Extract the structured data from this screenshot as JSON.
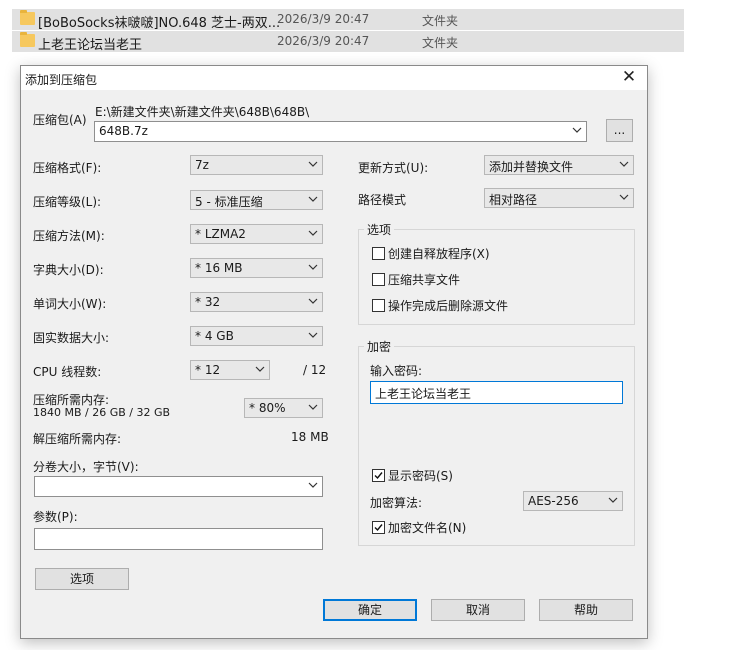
{
  "explorer": {
    "rows": [
      {
        "name": "[BoBoSocks袜啵啵]NO.648 芝士-两双...",
        "date": "2026/3/9 20:47",
        "type": "文件夹"
      },
      {
        "name": "上老王论坛当老王",
        "date": "2026/3/9 20:47",
        "type": "文件夹"
      }
    ]
  },
  "dialog": {
    "title": "添加到压缩包",
    "archive": {
      "label": "压缩包(A)",
      "path": "E:\\新建文件夹\\新建文件夹\\648B\\648B\\",
      "value": "648B.7z",
      "browse": "..."
    },
    "format": {
      "label": "压缩格式(F):",
      "value": "7z"
    },
    "level": {
      "label": "压缩等级(L):",
      "value": "5 - 标准压缩"
    },
    "method": {
      "label": "压缩方法(M):",
      "value": "* LZMA2"
    },
    "dict": {
      "label": "字典大小(D):",
      "value": "* 16 MB"
    },
    "word": {
      "label": "单词大小(W):",
      "value": "* 32"
    },
    "solid": {
      "label": "固实数据大小:",
      "value": "* 4 GB"
    },
    "threads": {
      "label": "CPU 线程数:",
      "value": "* 12",
      "total": "/ 12"
    },
    "mem_comp": {
      "label": "压缩所需内存:",
      "detail": "1840 MB / 26 GB / 32 GB",
      "value": "* 80%"
    },
    "mem_decomp": {
      "label": "解压缩所需内存:",
      "value": "18 MB"
    },
    "volume": {
      "label": "分卷大小，字节(V):",
      "value": ""
    },
    "params": {
      "label": "参数(P):",
      "value": ""
    },
    "options_btn": "选项",
    "update": {
      "label": "更新方式(U):",
      "value": "添加并替换文件"
    },
    "pathmode": {
      "label": "路径模式",
      "value": "相对路径"
    },
    "options_group": {
      "title": "选项",
      "sfx": "创建自释放程序(X)",
      "shared": "压缩共享文件",
      "delete": "操作完成后删除源文件"
    },
    "encryption": {
      "title": "加密",
      "pw_label": "输入密码:",
      "pw_value": "上老王论坛当老王",
      "show_pw": "显示密码(S)",
      "algo_label": "加密算法:",
      "algo_value": "AES-256",
      "encrypt_names": "加密文件名(N)"
    },
    "buttons": {
      "ok": "确定",
      "cancel": "取消",
      "help": "帮助"
    }
  }
}
